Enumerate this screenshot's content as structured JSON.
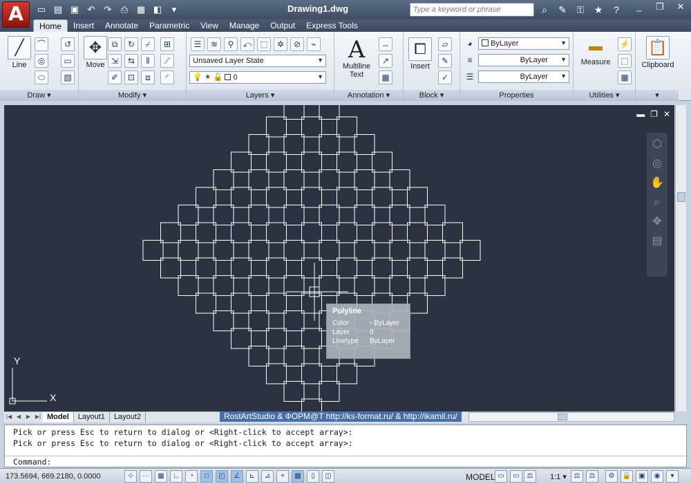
{
  "app": {
    "logo_letter": "A",
    "title": "Drawing1.dwg",
    "search_placeholder": "Type a keyword or phrase",
    "qat_icons": [
      "new-icon",
      "open-icon",
      "save-icon",
      "undo-icon",
      "redo-icon",
      "plot-icon",
      "publish-icon",
      "print-preview-icon",
      "workspace-icon"
    ],
    "window_controls": [
      "minimize-icon",
      "restore-icon",
      "close-icon"
    ]
  },
  "tabs": [
    {
      "label": "Home",
      "active": true
    },
    {
      "label": "Insert"
    },
    {
      "label": "Annotate"
    },
    {
      "label": "Parametric"
    },
    {
      "label": "View"
    },
    {
      "label": "Manage"
    },
    {
      "label": "Output"
    },
    {
      "label": "Express Tools"
    }
  ],
  "ribbon": {
    "draw": {
      "label": "Draw",
      "line": "Line"
    },
    "modify": {
      "label": "Modify",
      "move": "Move"
    },
    "layers": {
      "label": "Layers",
      "layer_state": "Unsaved Layer State",
      "current_layer": "0"
    },
    "annotation": {
      "label": "Annotation",
      "mtext_line1": "Multiline",
      "mtext_line2": "Text"
    },
    "block": {
      "label": "Block",
      "insert": "Insert"
    },
    "properties": {
      "label": "Properties",
      "color": "ByLayer",
      "linetype": "ByLayer",
      "lineweight": "ByLayer"
    },
    "utilities": {
      "label": "Utilities",
      "measure": "Measure"
    },
    "clipboard": {
      "label": "Clipboard"
    }
  },
  "tooltip": {
    "title": "Polyline",
    "rows": [
      {
        "key": "Color",
        "value": "ByLayer"
      },
      {
        "key": "Layer",
        "value": "0"
      },
      {
        "key": "Linetype",
        "value": "ByLayer"
      }
    ]
  },
  "layout_tabs": [
    "Model",
    "Layout1",
    "Layout2"
  ],
  "credit": "RostArtStudio & ФОРМ@T http://ks-format.ru/ & http://ikamil.ru/",
  "command": {
    "history": [
      "Pick or press Esc to return to dialog or <Right-click to accept array>:",
      "Pick or press Esc to return to dialog or <Right-click to accept array>:"
    ],
    "prompt": "Command:"
  },
  "status": {
    "coordinates": "173.5694, 669.2180, 0.0000",
    "space": "MODEL",
    "scale": "1:1"
  },
  "ucs": {
    "x": "X",
    "y": "Y"
  },
  "colors": {
    "canvas_bg": "#2b3340",
    "geometry": "#ffffff",
    "accent": "#4a6ea8"
  }
}
